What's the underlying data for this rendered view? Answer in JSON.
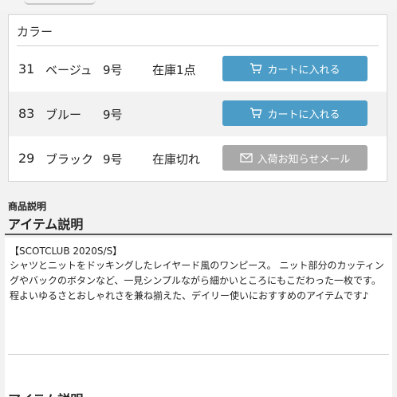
{
  "color_section": {
    "header": "カラー",
    "variants": [
      {
        "code": "31",
        "name": "ベージュ",
        "size": "9号",
        "stock": "在庫1点",
        "button": "カートに入れる",
        "button_type": "cart"
      },
      {
        "code": "83",
        "name": "ブルー",
        "size": "9号",
        "stock": "",
        "button": "カートに入れる",
        "button_type": "cart"
      },
      {
        "code": "29",
        "name": "ブラック",
        "size": "9号",
        "stock": "在庫切れ",
        "button": "入荷お知らせメール",
        "button_type": "notify"
      }
    ]
  },
  "description": {
    "section_label": "商品説明",
    "title": "アイテム説明",
    "heading": "【SCOTCLUB 2020S/S】",
    "body": "シャツとニットをドッキングしたレイヤード風のワンピース。 ニット部分のカッティングやバックのボタンなど、一見シンプルながら細かいところにもこだわった一枚です。 程よいゆるさとおしゃれさを兼ね揃えた、デイリー使いにおすすめのアイテムです♪",
    "next_title": "アイテム説明"
  },
  "colors": {
    "cart_button": "#4b9cc6",
    "notify_button": "#a9a9a9",
    "row_shade": "#f2f2f2"
  },
  "icons": {
    "cart": "cart-icon",
    "mail": "mail-icon"
  }
}
